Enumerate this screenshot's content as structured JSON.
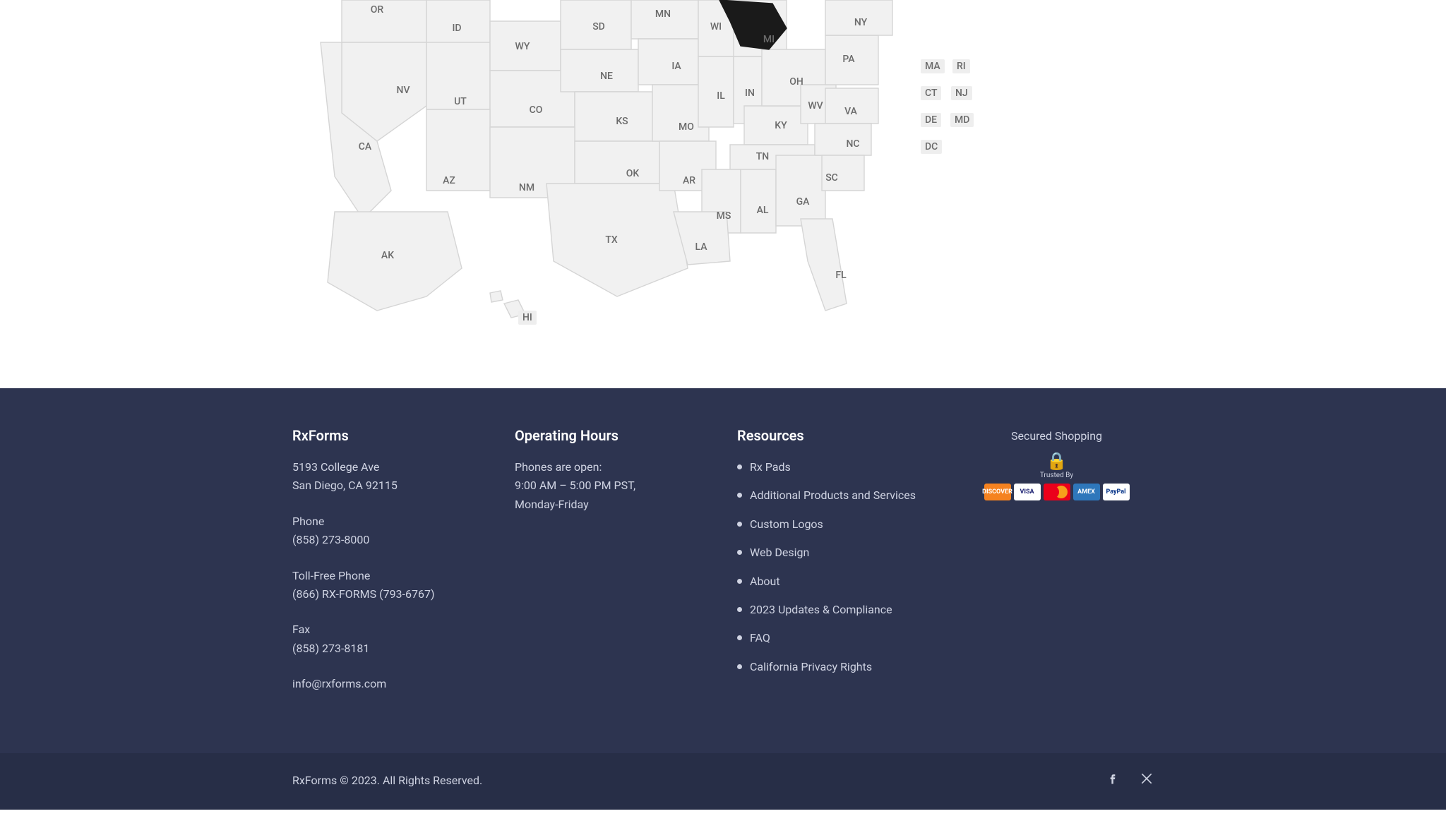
{
  "map": {
    "states": {
      "OR": "OR",
      "ID": "ID",
      "SD": "SD",
      "MN": "MN",
      "WI": "WI",
      "MI": "MI",
      "NY": "NY",
      "WY": "WY",
      "NE": "NE",
      "IA": "IA",
      "OH": "OH",
      "PA": "PA",
      "NV": "NV",
      "UT": "UT",
      "CO": "CO",
      "IL": "IL",
      "IN": "IN",
      "WV": "WV",
      "VA": "VA",
      "CA": "CA",
      "KS": "KS",
      "MO": "MO",
      "KY": "KY",
      "NC": "NC",
      "AZ": "AZ",
      "NM": "NM",
      "OK": "OK",
      "AR": "AR",
      "TN": "TN",
      "SC": "SC",
      "MS": "MS",
      "AL": "AL",
      "GA": "GA",
      "TX": "TX",
      "LA": "LA",
      "FL": "FL",
      "AK": "AK",
      "HI": "HI",
      "MA": "MA",
      "RI": "RI",
      "CT": "CT",
      "NJ": "NJ",
      "DE": "DE",
      "MD": "MD",
      "DC": "DC"
    }
  },
  "footer": {
    "company": {
      "heading": "RxForms",
      "address_line1": "5193 College Ave",
      "address_line2": "San Diego, CA 92115",
      "phone_label": "Phone",
      "phone_value": "(858) 273-8000",
      "tollfree_label": "Toll-Free Phone",
      "tollfree_value": "(866) RX-FORMS (793-6767)",
      "fax_label": "Fax",
      "fax_value": "(858) 273-8181",
      "email": "info@rxforms.com"
    },
    "hours": {
      "heading": "Operating Hours",
      "line1": "Phones are open:",
      "line2": "9:00 AM – 5:00 PM PST,",
      "line3": "Monday-Friday"
    },
    "resources": {
      "heading": "Resources",
      "items": [
        "Rx Pads",
        "Additional Products and Services",
        "Custom Logos",
        "Web Design",
        "About",
        "2023 Updates & Compliance",
        "FAQ",
        "California Privacy Rights"
      ]
    },
    "secured": {
      "title": "Secured Shopping",
      "trusted_by": "Trusted By",
      "cards": {
        "discover": "DISCOVER",
        "visa": "VISA",
        "mc": "",
        "amex": "AMEX",
        "paypal": "PayPal"
      }
    },
    "copyright": "RxForms © 2023. All Rights Reserved."
  }
}
